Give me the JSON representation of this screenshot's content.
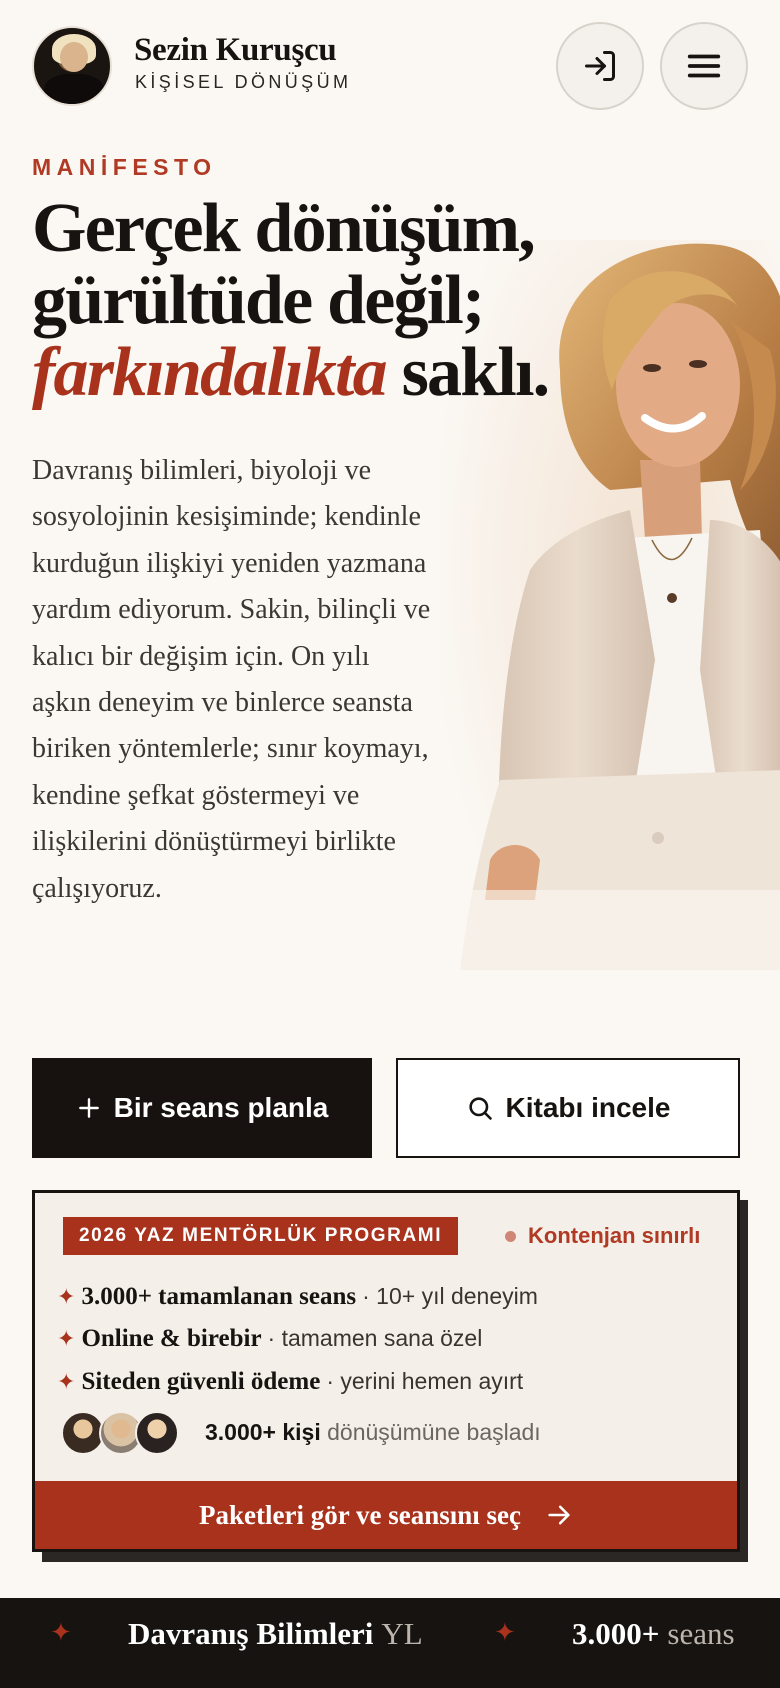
{
  "header": {
    "name": "Sezin Kuruşcu",
    "subtitle": "KİŞİSEL DÖNÜŞÜM",
    "login_icon": "login-arrow-icon",
    "menu_icon": "hamburger-menu-icon"
  },
  "hero": {
    "eyebrow": "MANİFESTO",
    "title_line1": "Gerçek dönüşüm,",
    "title_line2": "gürültüde değil;",
    "title_emphasis": "farkındalıkta",
    "title_end": "saklı.",
    "description": "Davranış bilimleri, biyoloji ve sosyolojinin kesişiminde; kendinle kurduğun ilişkiyi yeniden yazmana yardım ediyorum. Sakin, bilinçli ve kalıcı bir değişim için. On yılı aşkın deneyim ve binlerce seansta biriken yöntemlerle; sınır koymayı, kendine şefkat göstermeyi ve ilişkilerini dönüştürmeyi birlikte çalışıyoruz."
  },
  "actions": {
    "primary_label": "Bir seans planla",
    "primary_icon": "plus-icon",
    "secondary_label": "Kitabı incele",
    "secondary_icon": "search-icon"
  },
  "program": {
    "tag": "2026 YAZ MENTÖRLÜK PROGRAMI",
    "status": "Kontenjan sınırlı",
    "features": [
      {
        "bold": "3.000+ tamamlanan seans",
        "rest": "· 10+ yıl deneyim"
      },
      {
        "bold": "Online & birebir",
        "rest": "· tamamen sana özel"
      },
      {
        "bold": "Siteden güvenli ödeme",
        "rest": "· yerini hemen ayırt"
      }
    ],
    "social_bold": "3.000+ kişi",
    "social_rest": "dönüşümüne başladı",
    "cta_label": "Paketleri gör ve seansını seç",
    "cta_icon": "arrow-right-icon"
  },
  "marquee": {
    "item1_bold": "Davranış Bilimleri",
    "item1_light": "YL",
    "item2_bold": "3.000+",
    "item2_light": "seans"
  },
  "colors": {
    "accent": "#a8321c",
    "dark": "#161311",
    "background": "#fbf8f4",
    "card": "#f4f0e9"
  }
}
